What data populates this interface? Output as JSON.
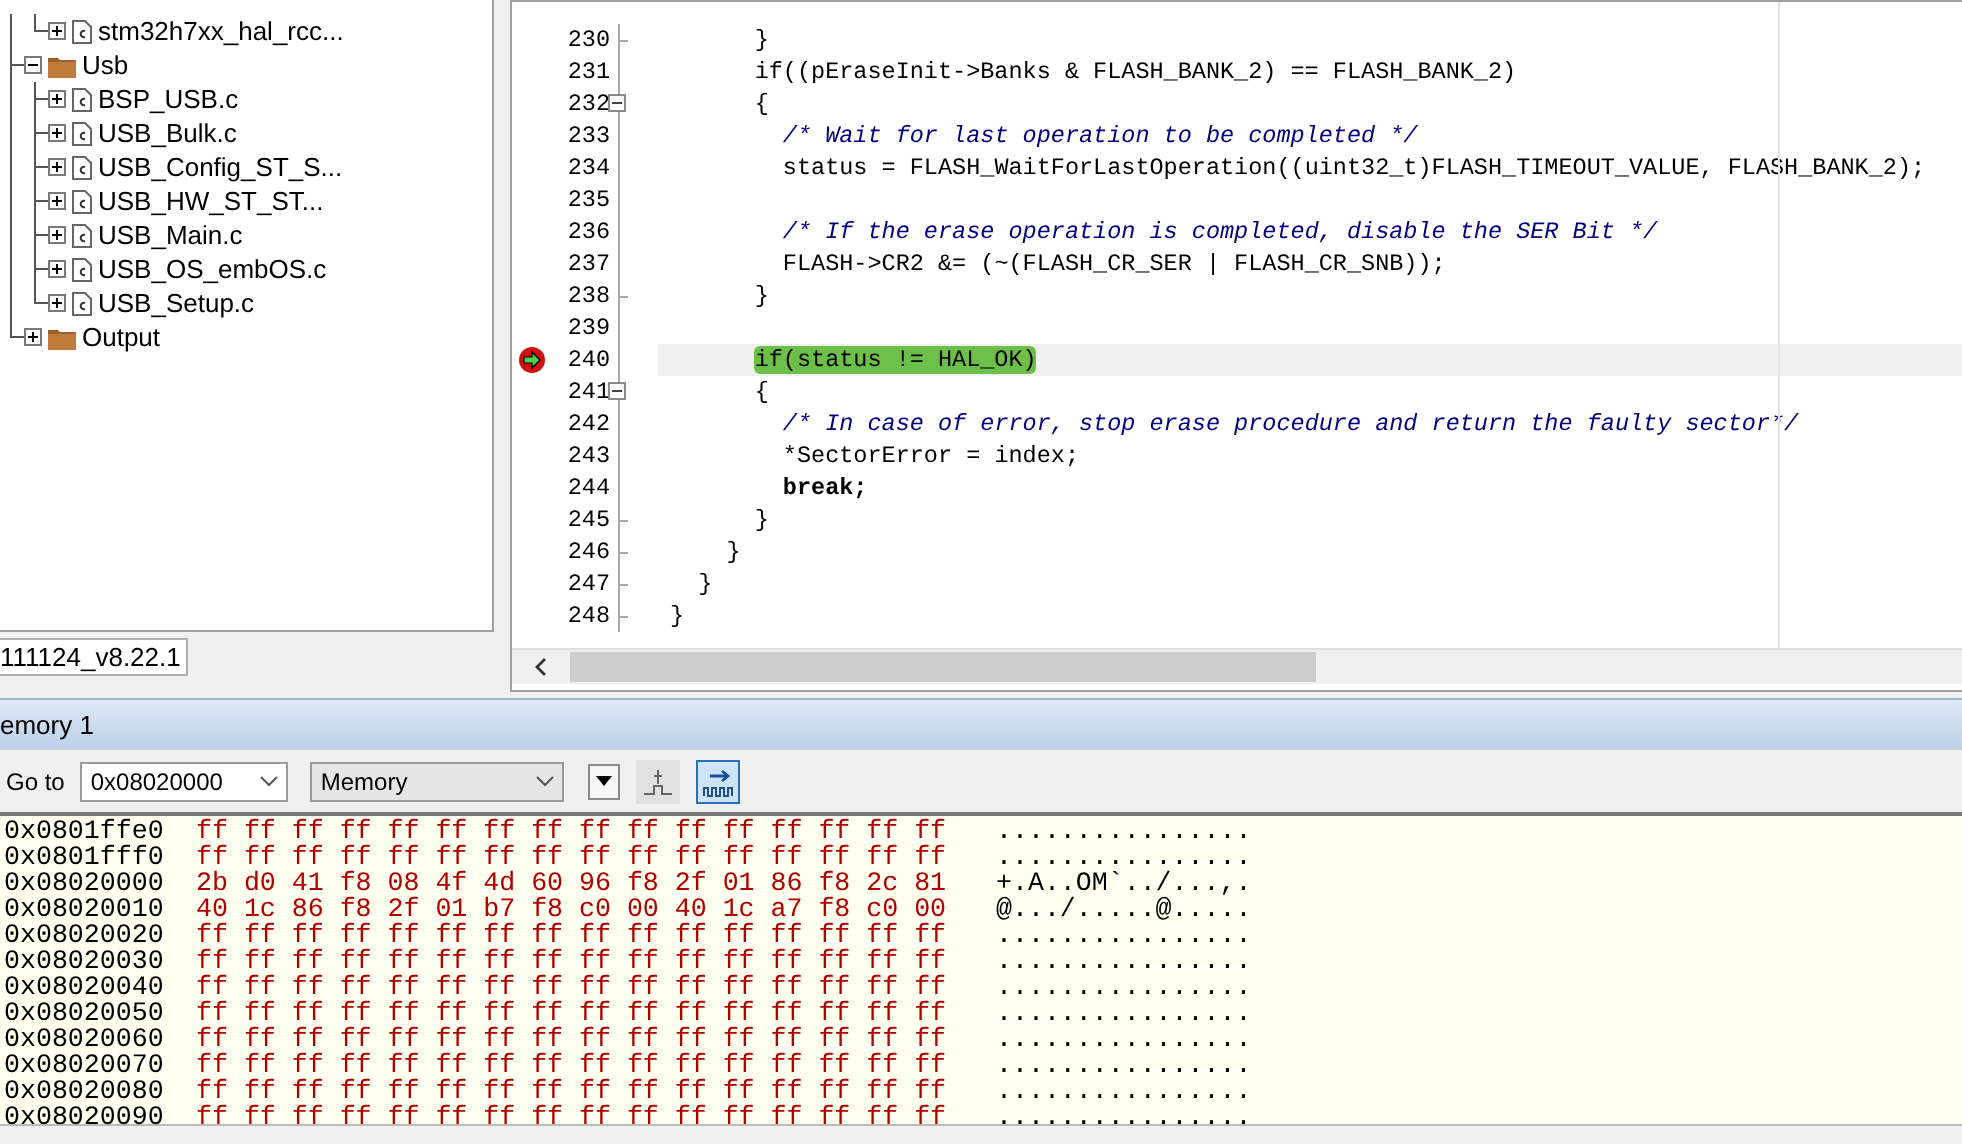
{
  "project_tree": [
    {
      "kind": "group-tail",
      "children": [
        {
          "kind": "file",
          "label": "stm32h7xx_hal_rcc...",
          "expanded": false
        }
      ]
    },
    {
      "kind": "folder",
      "label": "Usb",
      "expanded": true,
      "children": [
        {
          "kind": "file",
          "label": "BSP_USB.c",
          "expanded": false
        },
        {
          "kind": "file",
          "label": "USB_Bulk.c",
          "expanded": false
        },
        {
          "kind": "file",
          "label": "USB_Config_ST_S...",
          "expanded": false
        },
        {
          "kind": "file",
          "label": "USB_HW_ST_ST...",
          "expanded": false
        },
        {
          "kind": "file",
          "label": "USB_Main.c",
          "expanded": false
        },
        {
          "kind": "file",
          "label": "USB_OS_embOS.c",
          "expanded": false
        },
        {
          "kind": "file",
          "label": "USB_Setup.c",
          "expanded": false
        }
      ]
    },
    {
      "kind": "folder",
      "label": "Output",
      "expanded": false
    }
  ],
  "workspace_tab": {
    "label": "111124_v8.22.1"
  },
  "editor": {
    "lines": [
      {
        "number": "230",
        "text": "      }",
        "kind": "code",
        "fold_open": false,
        "fold_end": true,
        "current": false
      },
      {
        "number": "231",
        "text": "      if((pEraseInit->Banks & FLASH_BANK_2) == FLASH_BANK_2)",
        "kind": "code",
        "fold_open": false,
        "fold_end": false,
        "current": false
      },
      {
        "number": "232",
        "text": "      {",
        "kind": "code",
        "fold_open": true,
        "fold_end": false,
        "current": false
      },
      {
        "number": "233",
        "text": "        /* Wait for last operation to be completed */",
        "kind": "comment",
        "fold_open": false,
        "fold_end": false,
        "current": false
      },
      {
        "number": "234",
        "text": "        status = FLASH_WaitForLastOperation((uint32_t)FLASH_TIMEOUT_VALUE, FLASH_BANK_2);",
        "kind": "code",
        "fold_open": false,
        "fold_end": false,
        "current": false
      },
      {
        "number": "235",
        "kind": "code",
        "fold_open": false,
        "fold_end": false,
        "current": false
      },
      {
        "number": "236",
        "text": "        /* If the erase operation is completed, disable the SER Bit */",
        "kind": "comment",
        "fold_open": false,
        "fold_end": false,
        "current": false
      },
      {
        "number": "237",
        "text": "        FLASH->CR2 &= (~(FLASH_CR_SER | FLASH_CR_SNB));",
        "kind": "code",
        "fold_open": false,
        "fold_end": false,
        "current": false
      },
      {
        "number": "238",
        "text": "      }",
        "kind": "code",
        "fold_open": false,
        "fold_end": true,
        "current": false
      },
      {
        "number": "239",
        "kind": "code",
        "fold_open": false,
        "fold_end": false,
        "current": false
      },
      {
        "number": "240",
        "text": "      if(status != HAL_OK)",
        "kind": "code",
        "fold_open": false,
        "fold_end": false,
        "current": true
      },
      {
        "number": "241",
        "text": "      {",
        "kind": "code",
        "fold_open": true,
        "fold_end": false,
        "current": false
      },
      {
        "number": "242",
        "text": "        /* In case of error, stop erase procedure and return the faulty sector*/",
        "kind": "comment",
        "fold_open": false,
        "fold_end": false,
        "current": false
      },
      {
        "number": "243",
        "text": "        *SectorError = index;",
        "kind": "code",
        "fold_open": false,
        "fold_end": false,
        "current": false
      },
      {
        "number": "244",
        "text": "        break;",
        "kind": "keyword",
        "fold_open": false,
        "fold_end": false,
        "current": false
      },
      {
        "number": "245",
        "text": "      }",
        "kind": "code",
        "fold_open": false,
        "fold_end": true,
        "current": false
      },
      {
        "number": "246",
        "text": "    }",
        "kind": "code",
        "fold_open": false,
        "fold_end": true,
        "current": false
      },
      {
        "number": "247",
        "text": "  }",
        "kind": "code",
        "fold_open": false,
        "fold_end": true,
        "current": false
      },
      {
        "number": "248",
        "text": "}",
        "kind": "code",
        "fold_open": false,
        "fold_end": true,
        "current": false
      }
    ]
  },
  "memory": {
    "title": "emory 1",
    "toolbar": {
      "goto_label": "Go to",
      "address": "0x08020000",
      "format": "Memory",
      "toggles": [
        {
          "pressed": false
        },
        {
          "pressed": true
        }
      ]
    },
    "rows": [
      {
        "address": "0x0801ffe0",
        "bytes": "ff ff ff ff ff ff ff ff ff ff ff ff ff ff ff ff",
        "ascii": "................"
      },
      {
        "address": "0x0801fff0",
        "bytes": "ff ff ff ff ff ff ff ff ff ff ff ff ff ff ff ff",
        "ascii": "................"
      },
      {
        "address": "0x08020000",
        "bytes": "2b d0 41 f8 08 4f 4d 60 96 f8 2f 01 86 f8 2c 81",
        "ascii": "+.A..OM`../...,."
      },
      {
        "address": "0x08020010",
        "bytes": "40 1c 86 f8 2f 01 b7 f8 c0 00 40 1c a7 f8 c0 00",
        "ascii": "@.../.....@....."
      },
      {
        "address": "0x08020020",
        "bytes": "ff ff ff ff ff ff ff ff ff ff ff ff ff ff ff ff",
        "ascii": "................"
      },
      {
        "address": "0x08020030",
        "bytes": "ff ff ff ff ff ff ff ff ff ff ff ff ff ff ff ff",
        "ascii": "................"
      },
      {
        "address": "0x08020040",
        "bytes": "ff ff ff ff ff ff ff ff ff ff ff ff ff ff ff ff",
        "ascii": "................"
      },
      {
        "address": "0x08020050",
        "bytes": "ff ff ff ff ff ff ff ff ff ff ff ff ff ff ff ff",
        "ascii": "................"
      },
      {
        "address": "0x08020060",
        "bytes": "ff ff ff ff ff ff ff ff ff ff ff ff ff ff ff ff",
        "ascii": "................"
      },
      {
        "address": "0x08020070",
        "bytes": "ff ff ff ff ff ff ff ff ff ff ff ff ff ff ff ff",
        "ascii": "................"
      },
      {
        "address": "0x08020080",
        "bytes": "ff ff ff ff ff ff ff ff ff ff ff ff ff ff ff ff",
        "ascii": "................"
      },
      {
        "address": "0x08020090",
        "bytes": "ff ff ff ff ff ff ff ff ff ff ff ff ff ff ff ff",
        "ascii": "................"
      }
    ]
  }
}
